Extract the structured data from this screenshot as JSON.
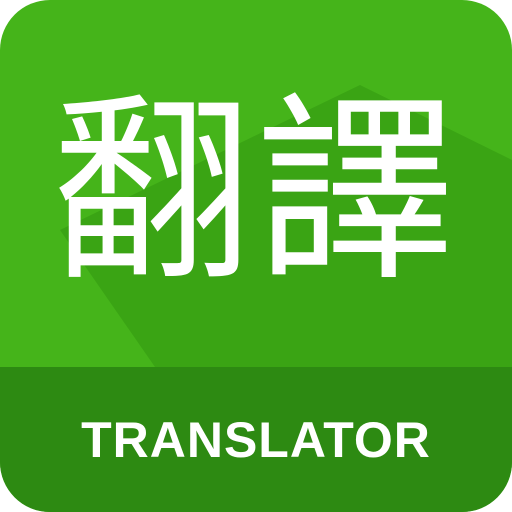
{
  "icon": {
    "glyphs": "翻譯",
    "caption": "TRANSLATOR",
    "colors": {
      "background": "#45b41a",
      "shadow": "#3aa414",
      "band": "#2d8a12",
      "text": "#ffffff"
    }
  }
}
